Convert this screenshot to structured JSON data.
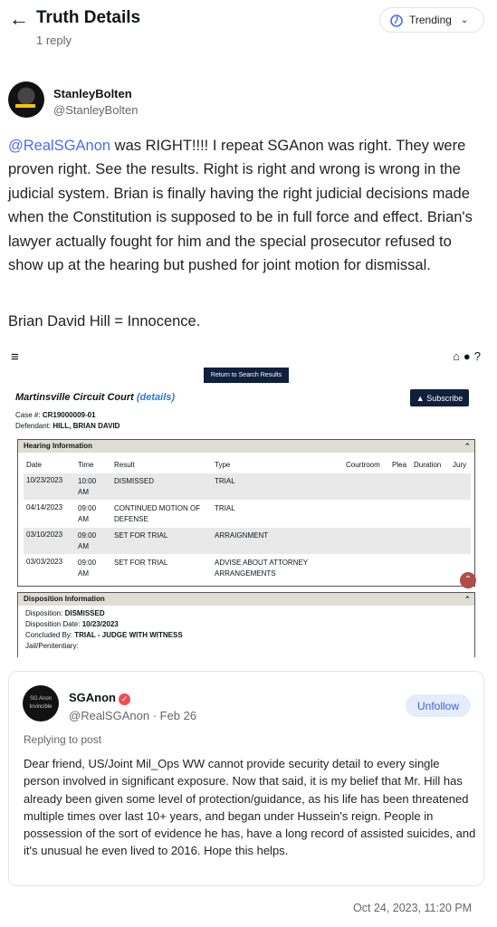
{
  "header": {
    "title": "Truth Details",
    "subtitle": "1 reply",
    "trending_label": "Trending"
  },
  "post": {
    "author_name": "StanleyBolten",
    "author_handle": "@StanleyBolten",
    "mention": "@RealSGAnon",
    "text_after_mention": " was RIGHT!!!! I repeat SGAnon was right. They were proven right. See the results. Right is right and wrong is wrong in the judicial system. Brian is finally having the right judicial decisions made when the Constitution is supposed to be in full force and effect. Brian's lawyer actually fought for him and the special prosecutor refused to show up at the hearing but pushed for joint motion for dismissal.",
    "text_line2": "Brian David Hill = Innocence.",
    "timestamp": "Oct 24, 2023, 11:20 PM"
  },
  "court_image": {
    "return_button": "Return to Search Results",
    "court_name": "Martinsville Circuit Court",
    "details_link": "(details)",
    "subscribe_label": "Subscribe",
    "case_label": "Case #:",
    "case_number": "CR19000009-01",
    "defendant_label": "Defendant:",
    "defendant": "HILL, BRIAN DAVID",
    "hearing_title": "Hearing Information",
    "columns": [
      "Date",
      "Time",
      "Result",
      "Type",
      "Courtroom",
      "Plea",
      "Duration",
      "Jury"
    ],
    "hearings": [
      {
        "date": "10/23/2023",
        "time": "10:00 AM",
        "result": "DISMISSED",
        "type": "TRIAL"
      },
      {
        "date": "04/14/2023",
        "time": "09:00 AM",
        "result": "CONTINUED MOTION OF DEFENSE",
        "type": "TRIAL"
      },
      {
        "date": "03/10/2023",
        "time": "09:00 AM",
        "result": "SET FOR TRIAL",
        "type": "ARRAIGNMENT"
      },
      {
        "date": "03/03/2023",
        "time": "09:00 AM",
        "result": "SET FOR TRIAL",
        "type": "ADVISE ABOUT ATTORNEY ARRANGEMENTS"
      }
    ],
    "disposition_title": "Disposition Information",
    "disposition_label": "Disposition:",
    "disposition": "DISMISSED",
    "disposition_date_label": "Disposition Date:",
    "disposition_date": "10/23/2023",
    "concluded_label": "Concluded By:",
    "concluded_by": "TRIAL - JUDGE WITH WITNESS",
    "jail_label": "Jail/Penitentiary:"
  },
  "quoted": {
    "avatar_text": "SG Anon Invincible",
    "name": "SGAnon",
    "handle": "@RealSGAnon",
    "date": "Feb 26",
    "handle_date": "@RealSGAnon · Feb 26",
    "unfollow_label": "Unfollow",
    "replying_to": "Replying to post",
    "text": "Dear friend, US/Joint Mil_Ops WW cannot provide security detail to every single person involved in significant exposure. Now that said, it is my belief that Mr. Hill has already been given some level of protection/guidance, as his life has been threatened multiple times over last 10+ years, and began under Hussein's reign. People in possession of the sort of evidence he has, have a long record of assisted suicides, and it's unusual he even lived to 2016. Hope this helps."
  },
  "colors": {
    "accent_blue": "#4a6cf7",
    "verified_red": "#ef4e4e",
    "court_navy": "#0f1f3d"
  }
}
